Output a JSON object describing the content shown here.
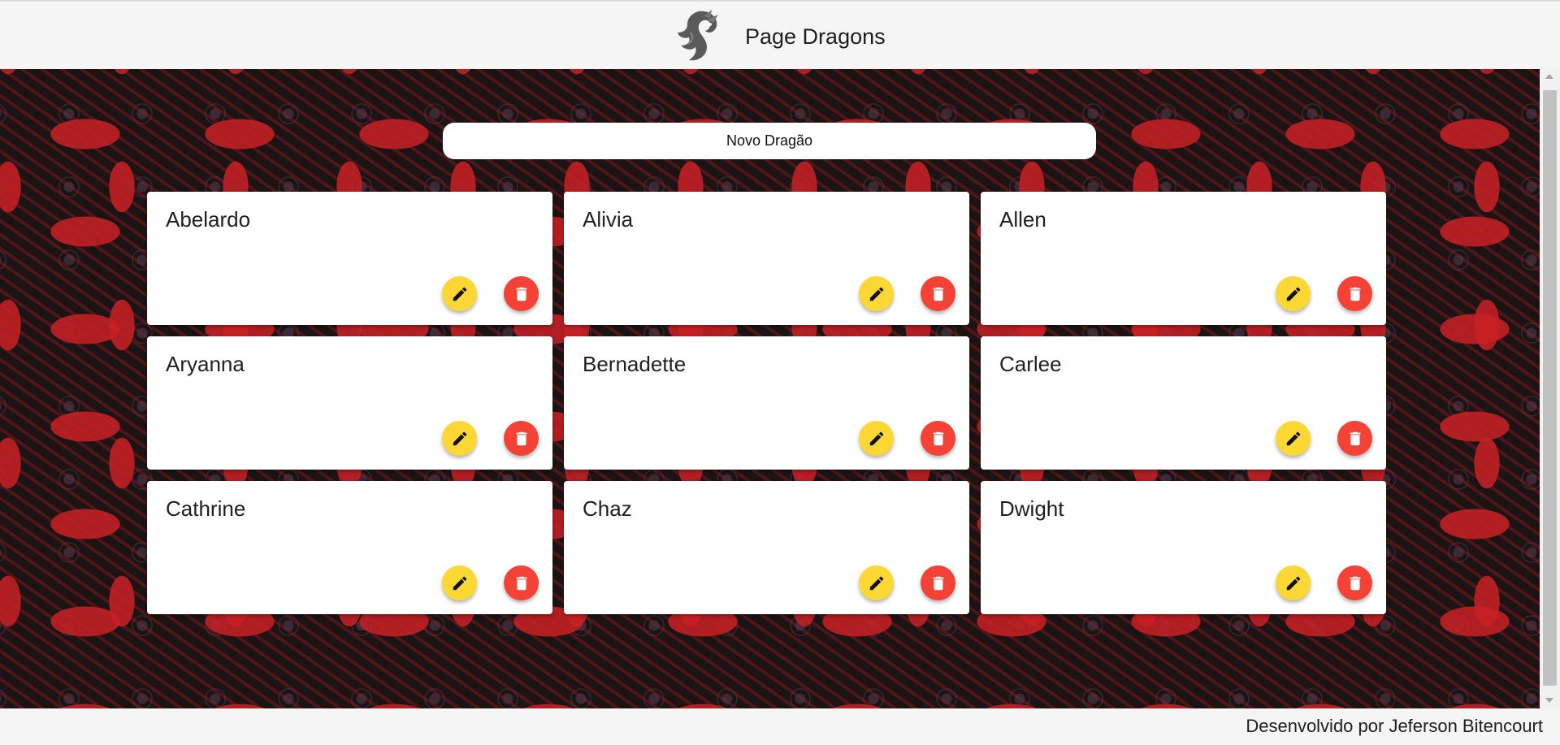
{
  "header": {
    "title": "Page Dragons",
    "logo_icon": "dragon-logo-icon"
  },
  "main": {
    "new_button_label": "Novo Dragão",
    "cards": [
      {
        "name": "Abelardo"
      },
      {
        "name": "Alivia"
      },
      {
        "name": "Allen"
      },
      {
        "name": "Aryanna"
      },
      {
        "name": "Bernadette"
      },
      {
        "name": "Carlee"
      },
      {
        "name": "Cathrine"
      },
      {
        "name": "Chaz"
      },
      {
        "name": "Dwight"
      }
    ],
    "edit_icon": "pencil-icon",
    "delete_icon": "trash-icon"
  },
  "footer": {
    "credit": "Desenvolvido por Jeferson Bitencourt"
  },
  "colors": {
    "edit_button": "#fdd835",
    "delete_button": "#f44336",
    "pattern_red": "#c82024",
    "pattern_dark": "#1c1414"
  }
}
